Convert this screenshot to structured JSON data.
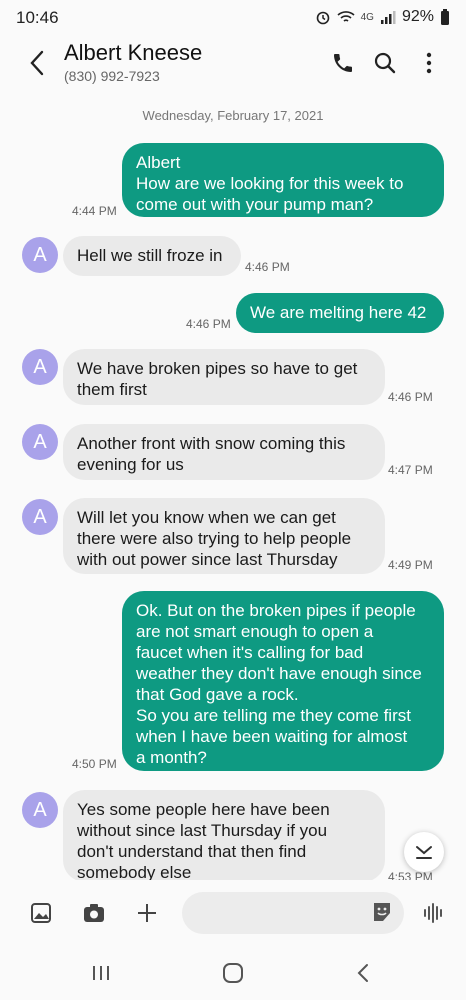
{
  "status_bar": {
    "time": "10:46",
    "network": "4G",
    "battery": "92%"
  },
  "header": {
    "name": "Albert Kneese",
    "number": "(830) 992-7923"
  },
  "date_separator": "Wednesday, February 17, 2021",
  "messages": [
    {
      "dir": "out",
      "text": "Albert\nHow are we looking for this week to\ncome out with your pump man?",
      "time": "4:44 PM"
    },
    {
      "dir": "in",
      "avatar": "A",
      "text": "Hell we still froze in",
      "time": "4:46 PM"
    },
    {
      "dir": "out",
      "text": "We are melting here 42",
      "time": "4:46 PM"
    },
    {
      "dir": "in",
      "avatar": "A",
      "text": "We have broken pipes so have to get\nthem first",
      "time": "4:46 PM"
    },
    {
      "dir": "in",
      "avatar": "A",
      "text": "Another front with snow coming this\nevening for us",
      "time": "4:47 PM"
    },
    {
      "dir": "in",
      "avatar": "A",
      "text": "Will let you know when we can get\nthere were also trying to help people\nwith out power since last Thursday",
      "time": "4:49 PM"
    },
    {
      "dir": "out",
      "text": "Ok. But on the broken pipes if people\nare not smart enough to open a\nfaucet when it's calling for bad\nweather they don't have enough since\nthat God gave a rock.\nSo you are telling me they come first\nwhen I have been waiting for almost\na month?",
      "time": "4:50 PM"
    },
    {
      "dir": "in",
      "avatar": "A",
      "text": "Yes some people here have been\nwithout since last Thursday if you\ndon't understand that then find\nsomebody else",
      "time": "4:53 PM"
    }
  ],
  "input": {
    "value": "",
    "placeholder": ""
  },
  "icons": {
    "back": "back-arrow-icon",
    "call": "phone-icon",
    "search": "search-icon",
    "more": "more-vert-icon",
    "scroll": "chevron-down-icon",
    "gallery": "image-icon",
    "camera": "camera-icon",
    "add": "plus-icon",
    "sticker": "sticker-icon",
    "voice": "voice-wave-icon",
    "recents": "recents-icon",
    "home": "home-icon",
    "nav_back": "nav-back-icon"
  },
  "colors": {
    "outgoing_bubble": "#0e9a82",
    "incoming_bubble": "#eaeaea",
    "avatar": "#a9a2ea"
  }
}
